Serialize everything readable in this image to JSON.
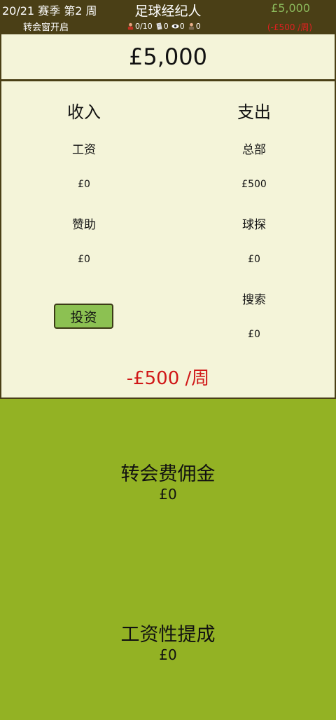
{
  "header": {
    "season": "20/21 赛季 第2 周",
    "transfer_window": "转会窗开启",
    "title": "足球经纪人",
    "money": "£5,000",
    "weekly_rate": "(-£500 /周)",
    "stats": {
      "players": "0/10",
      "contracts": "0",
      "scouts": "0",
      "staff": "0"
    }
  },
  "balance": "£5,000",
  "income": {
    "heading": "收入",
    "items": [
      {
        "label": "工资",
        "value": "£0"
      },
      {
        "label": "赞助",
        "value": "£0"
      }
    ],
    "invest_button": "投资"
  },
  "expense": {
    "heading": "支出",
    "items": [
      {
        "label": "总部",
        "value": "£500"
      },
      {
        "label": "球探",
        "value": "£0"
      },
      {
        "label": "搜索",
        "value": "£0"
      }
    ]
  },
  "net_weekly": "-£500 /周",
  "commissions": [
    {
      "label": "转会费佣金",
      "value": "£0"
    },
    {
      "label": "工资性提成",
      "value": "£0"
    }
  ],
  "colors": {
    "topbar": "#4a3f16",
    "panel": "#f4f4d9",
    "commission_bg": "#93b224",
    "button": "#8cc152",
    "money_green": "#8cba5c",
    "negative_red": "#d01818"
  }
}
